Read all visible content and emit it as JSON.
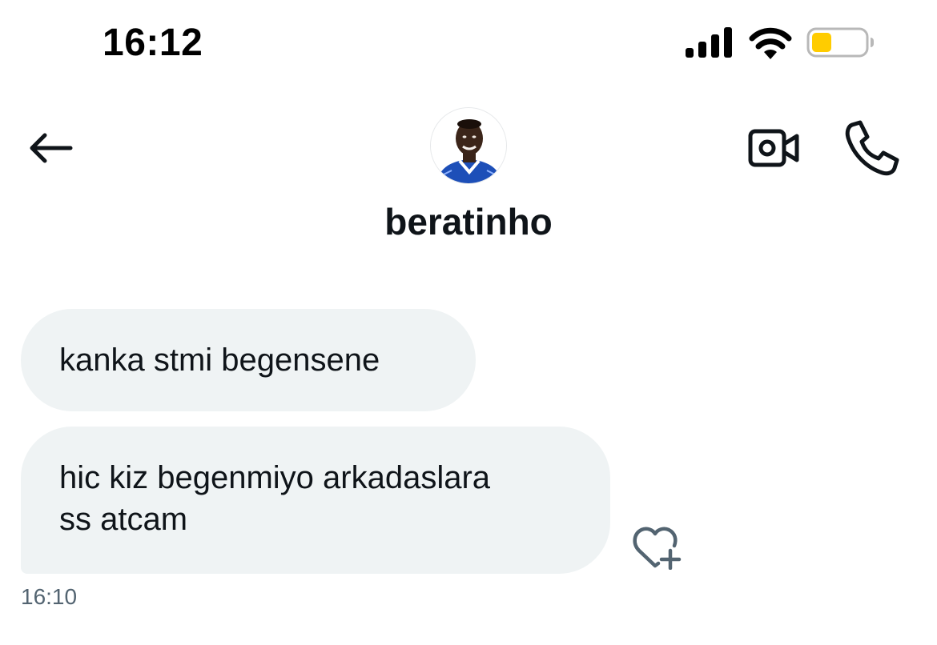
{
  "status_bar": {
    "time": "16:12",
    "signal_icon": "cellular-signal-icon",
    "wifi_icon": "wifi-icon",
    "battery_icon": "battery-low-icon",
    "battery_color": "#ffcc00"
  },
  "header": {
    "back_icon": "back-arrow-icon",
    "username": "beratinho",
    "video_icon": "video-call-icon",
    "call_icon": "phone-icon"
  },
  "messages": [
    {
      "text": "kanka stmi begensene"
    },
    {
      "text": "hic kiz begenmiyo arkadaslara\nss atcam"
    }
  ],
  "last_message_time": "16:10",
  "reaction": {
    "icon": "heart-plus-icon"
  },
  "colors": {
    "bubble_bg": "#eff3f4",
    "text": "#0f1419",
    "muted": "#536471"
  }
}
